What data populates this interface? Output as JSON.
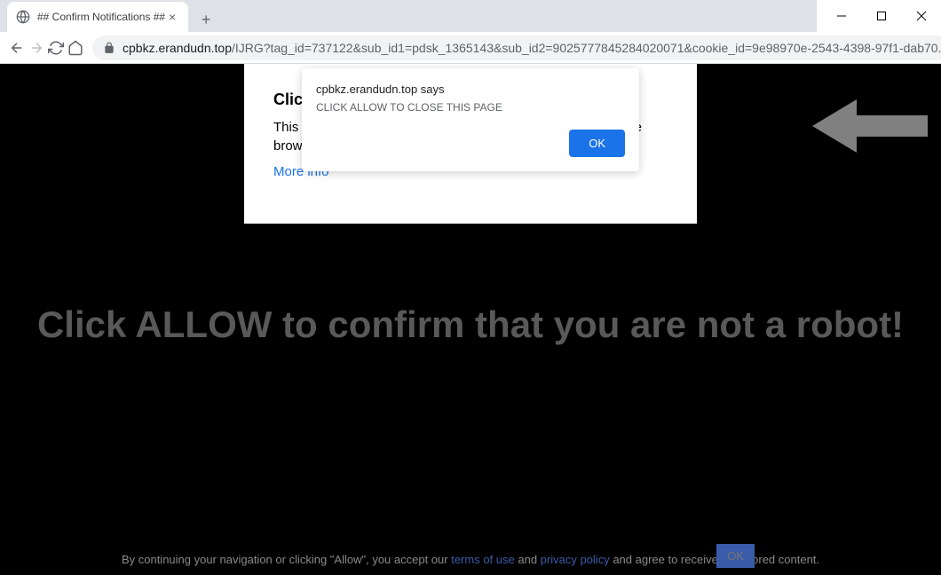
{
  "window": {
    "tab_title": "## Confirm Notifications ##"
  },
  "toolbar": {
    "url_domain": "cpbkz.erandudn.top",
    "url_path": "/IJRG?tag_id=737122&sub_id1=pdsk_1365143&sub_id2=9025777845284020071&cookie_id=9e98970e-2543-4398-97f1-dab70..."
  },
  "card": {
    "title_visible": "Clic",
    "text_line1": "This",
    "text_line2": "brow",
    "text_continuation": "ue",
    "link": "More info"
  },
  "dialog": {
    "origin": "cpbkz.erandudn.top says",
    "message": "CLICK ALLOW TO CLOSE THIS PAGE",
    "ok_label": "OK"
  },
  "main": {
    "headline": "Click ALLOW to confirm that you are not a robot!"
  },
  "footer": {
    "text_before": "By continuing your navigation or clicking \"Allow\", you accept our ",
    "terms_link": "terms of use",
    "and": " and ",
    "privacy_link": "privacy policy",
    "text_after": " and agree to receive sponsored content.",
    "ok_label": "OK"
  }
}
